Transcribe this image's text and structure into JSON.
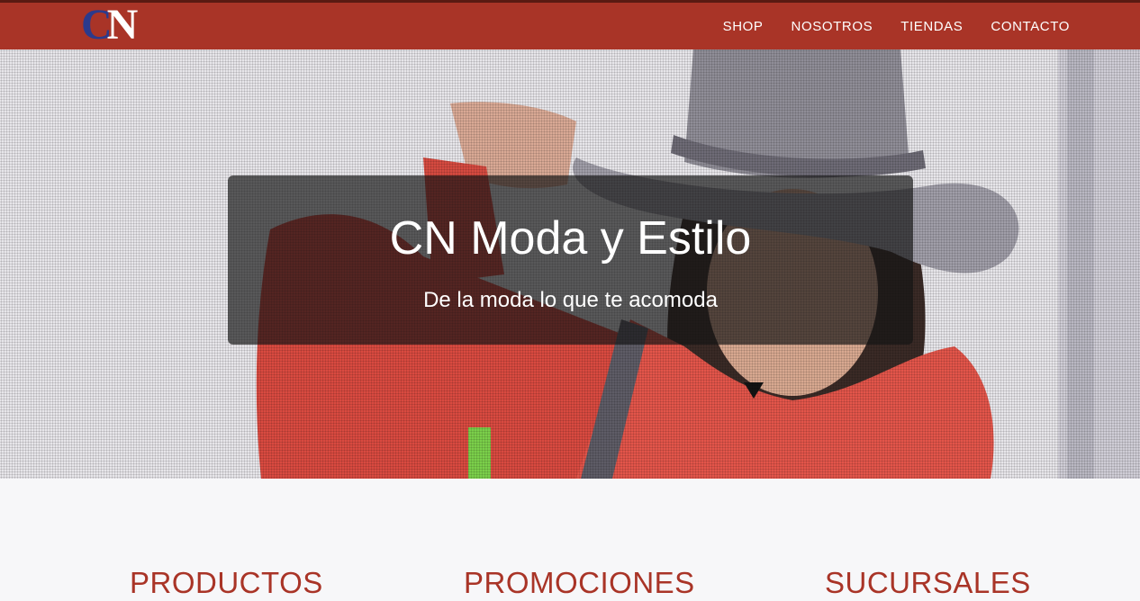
{
  "brand": {
    "logo_letter_1": "C",
    "logo_letter_2": "N",
    "colors": {
      "primary": "#a93427",
      "logo_blue": "#2b3a8c"
    }
  },
  "nav": {
    "items": [
      "SHOP",
      "NOSOTROS",
      "TIENDAS",
      "CONTACTO"
    ]
  },
  "hero": {
    "title": "CN Moda y Estilo",
    "subtitle": "De la moda lo que te acomoda"
  },
  "sections": [
    "PRODUCTOS",
    "PROMOCIONES",
    "SUCURSALES"
  ]
}
